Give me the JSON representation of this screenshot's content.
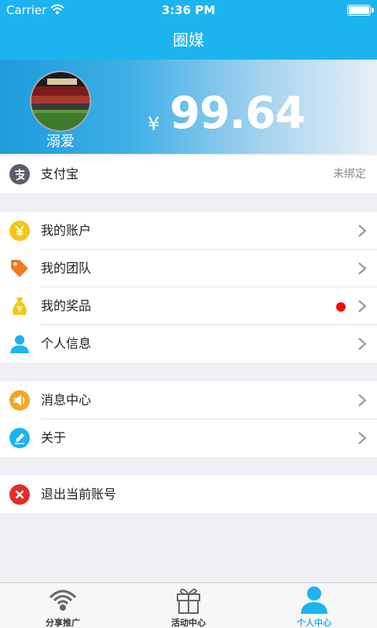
{
  "status_bar": {
    "carrier": "Carrier",
    "time": "3:36 PM"
  },
  "nav": {
    "title": "圈媒"
  },
  "profile": {
    "username": "溺爱",
    "currency_symbol": "¥",
    "balance": "99.64"
  },
  "alipay": {
    "label": "支付宝",
    "status": "未绑定"
  },
  "menu": {
    "account": "我的账户",
    "team": "我的团队",
    "prizes": "我的奖品",
    "personal_info": "个人信息",
    "messages": "消息中心",
    "about": "关于",
    "logout": "退出当前账号"
  },
  "tabs": [
    {
      "label": "分享推广",
      "icon": "wifi-share-icon"
    },
    {
      "label": "活动中心",
      "icon": "gift-icon"
    },
    {
      "label": "个人中心",
      "icon": "person-icon"
    }
  ],
  "colors": {
    "accent": "#1cb4ef",
    "badge": "#ff0000",
    "icon_yellow": "#f5c518",
    "icon_orange": "#f07a22",
    "icon_red": "#e52b2b"
  }
}
